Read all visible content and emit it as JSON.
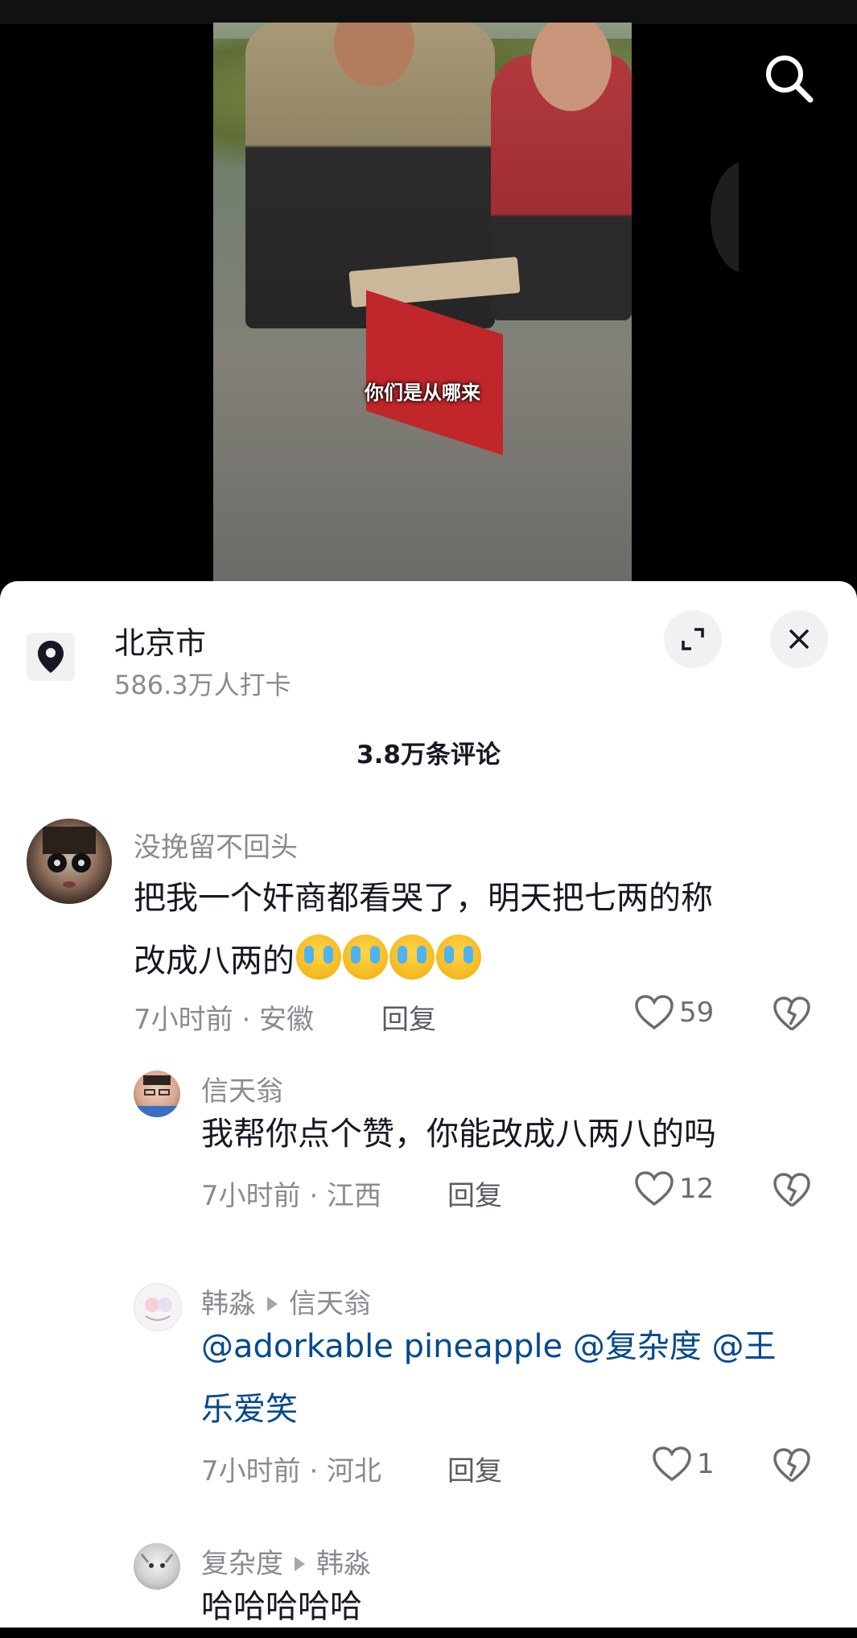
{
  "video": {
    "subtitle": "你们是从哪来"
  },
  "location": {
    "title": "北京市",
    "checkins": "586.3万人打卡"
  },
  "comments_header": {
    "count_label": "3.8万条评论"
  },
  "comments": [
    {
      "user": "没挽留不回头",
      "text_line1": "把我一个奸商都看哭了，明天把七两的称",
      "text_line2": "改成八两的",
      "emoji": [
        "crying-face",
        "crying-face",
        "crying-face",
        "crying-face"
      ],
      "meta": "7小时前 · 安徽",
      "reply_label": "回复",
      "likes": "59"
    }
  ],
  "replies": [
    {
      "user": "信天翁",
      "text": "我帮你点个赞，你能改成八两八的吗",
      "meta": "7小时前 · 江西",
      "reply_label": "回复",
      "likes": "12"
    },
    {
      "user": "韩淼",
      "reply_to": "信天翁",
      "text_line1": "@adorkable pineapple @复杂度 @王",
      "text_line2": "乐爱笑",
      "meta": "7小时前 · 河北",
      "reply_label": "回复",
      "likes": "1"
    },
    {
      "user": "复杂度",
      "reply_to": "韩淼",
      "text": "哈哈哈哈哈"
    }
  ],
  "colors": {
    "mention": "#04498d",
    "text": "#161823",
    "muted": "#8a8b91"
  }
}
